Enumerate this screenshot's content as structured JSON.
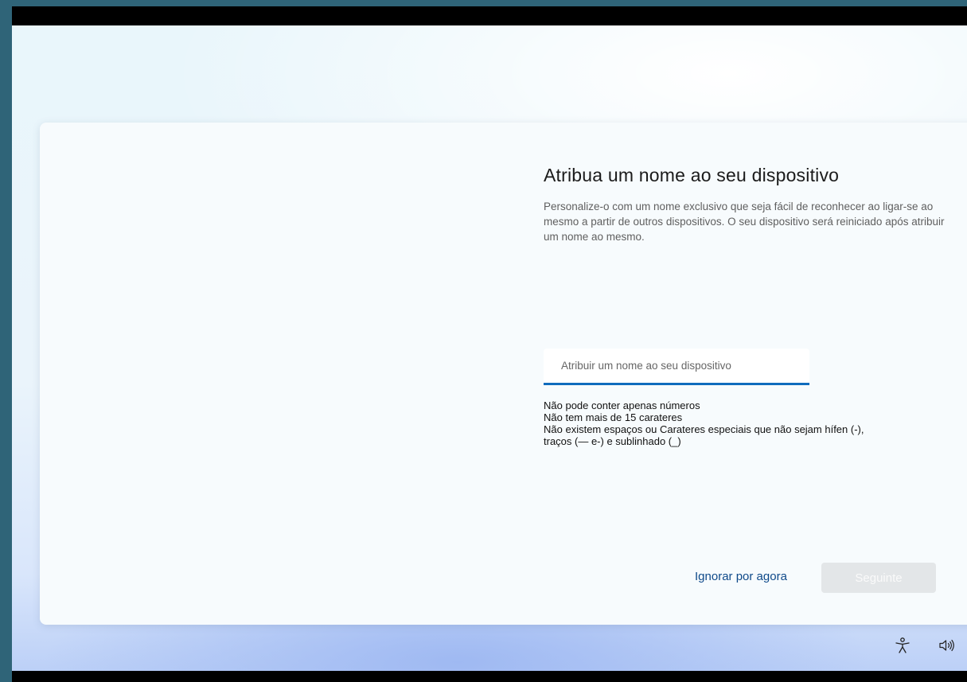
{
  "dialog": {
    "title": "Atribua um nome ao seu dispositivo",
    "description": "Personalize-o com um nome exclusivo que seja fácil de reconhecer ao ligar-se ao mesmo a partir de outros dispositivos. O seu dispositivo será reiniciado após atribuir um nome ao mesmo.",
    "name_input": {
      "value": "",
      "placeholder": "Atribuir um nome ao seu dispositivo"
    },
    "rules": [
      "Não pode conter apenas números",
      "Não tem mais de 15 carateres",
      "Não existem espaços ou Carateres especiais que não sejam hífen (-),",
      "traços (— e-) e sublinhado (_)"
    ],
    "skip_label": "Ignorar por agora",
    "next_label": "Seguinte"
  },
  "tray": {
    "accessibility_icon": "accessibility-icon",
    "volume_icon": "volume-icon"
  },
  "colors": {
    "accent": "#0f6cbd",
    "link": "#0f4a8a",
    "disabled_button": "#e3e6e8"
  }
}
